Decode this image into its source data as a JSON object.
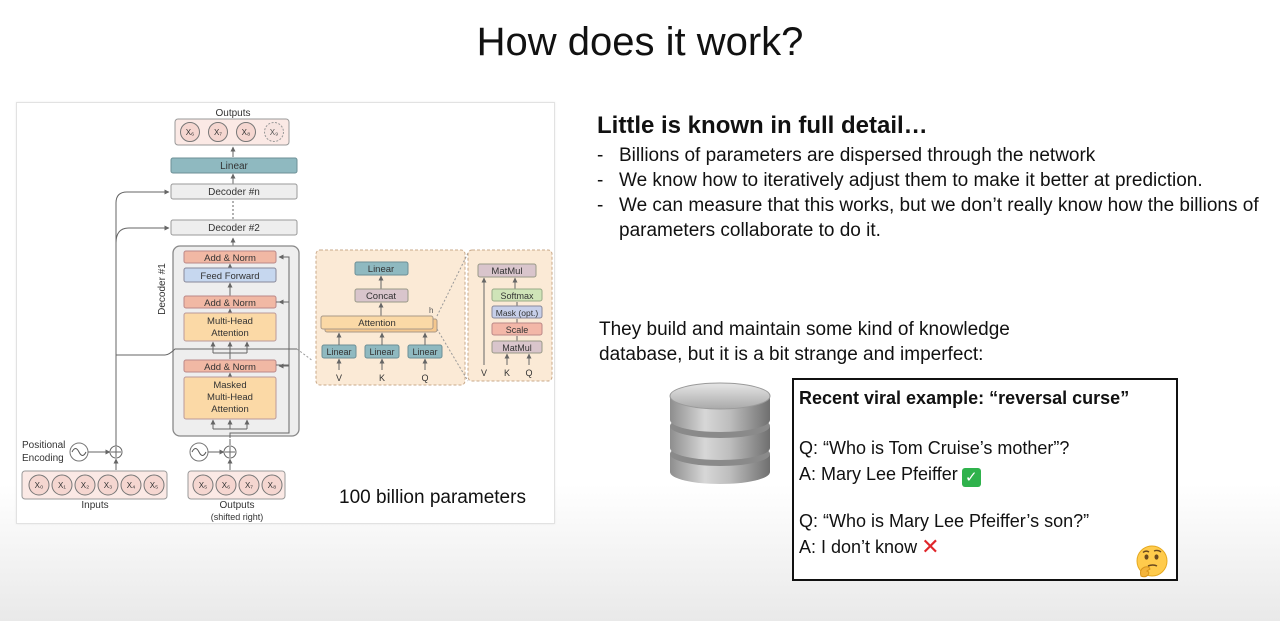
{
  "slide": {
    "title": "How does it work?",
    "heading": "Little is known in full detail…",
    "bullets": [
      "Billions of parameters are dispersed through the network",
      "We know how to iteratively adjust them to make it better at prediction.",
      "We can measure that this works, but we don’t really know how the billions of parameters collaborate to do it."
    ],
    "kb_text": "They build and maintain some kind of knowledge database, but it is a bit strange and imperfect:",
    "example": {
      "title": "Recent viral example: “reversal curse”",
      "q1": "Q: “Who is Tom Cruise’s mother”?",
      "a1": "A: Mary Lee Pfeiffer",
      "q2": "Q: “Who is Mary Lee Pfeiffer’s son?”",
      "a2": "A: I don’t know"
    },
    "params_label": "100 billion parameters"
  },
  "diagram": {
    "outputs_label": "Outputs",
    "output_tokens": [
      "X₆",
      "X₇",
      "X₈",
      "X₉"
    ],
    "linear": "Linear",
    "decoder_n": "Decoder #n",
    "decoder_2": "Decoder #2",
    "decoder_1": "Decoder #1",
    "add_norm": "Add & Norm",
    "feed_forward": "Feed Forward",
    "mha_line1": "Multi-Head",
    "mha_line2": "Attention",
    "masked_line1": "Masked",
    "masked_line2": "Multi-Head",
    "masked_line3": "Attention",
    "positional_line1": "Positional",
    "positional_line2": "Encoding",
    "inputs_label": "Inputs",
    "input_tokens": [
      "X₀",
      "X₁",
      "X₂",
      "X₃",
      "X₄",
      "X₅"
    ],
    "shifted_label1": "Outputs",
    "shifted_label2": "(shifted right)",
    "shifted_tokens": [
      "X₅",
      "X₆",
      "X₇",
      "X₈"
    ],
    "mh_linear": "Linear",
    "mh_concat": "Concat",
    "mh_attention": "Attention",
    "mh_h": "h",
    "mh_v": "V",
    "mh_k": "K",
    "mh_q": "Q",
    "sdp_matmul": "MatMul",
    "sdp_softmax": "Softmax",
    "sdp_mask": "Mask (opt.)",
    "sdp_scale": "Scale"
  },
  "colors": {
    "linear": "#8fb9c0",
    "add_norm": "#f1b8a4",
    "feed_forward": "#c6d7ef",
    "attention": "#fbd9a6",
    "decoder_box": "#eeeeee",
    "token": "#f5d6d0",
    "mh_panel": "#fbead6",
    "matmul": "#d9c5cc",
    "softmax": "#cfe4b8",
    "mask": "#c7cfe9",
    "scale": "#f3b7a8"
  },
  "icons": [
    "database-icon",
    "check-mark-icon",
    "cross-mark-icon",
    "thinking-face-icon"
  ]
}
